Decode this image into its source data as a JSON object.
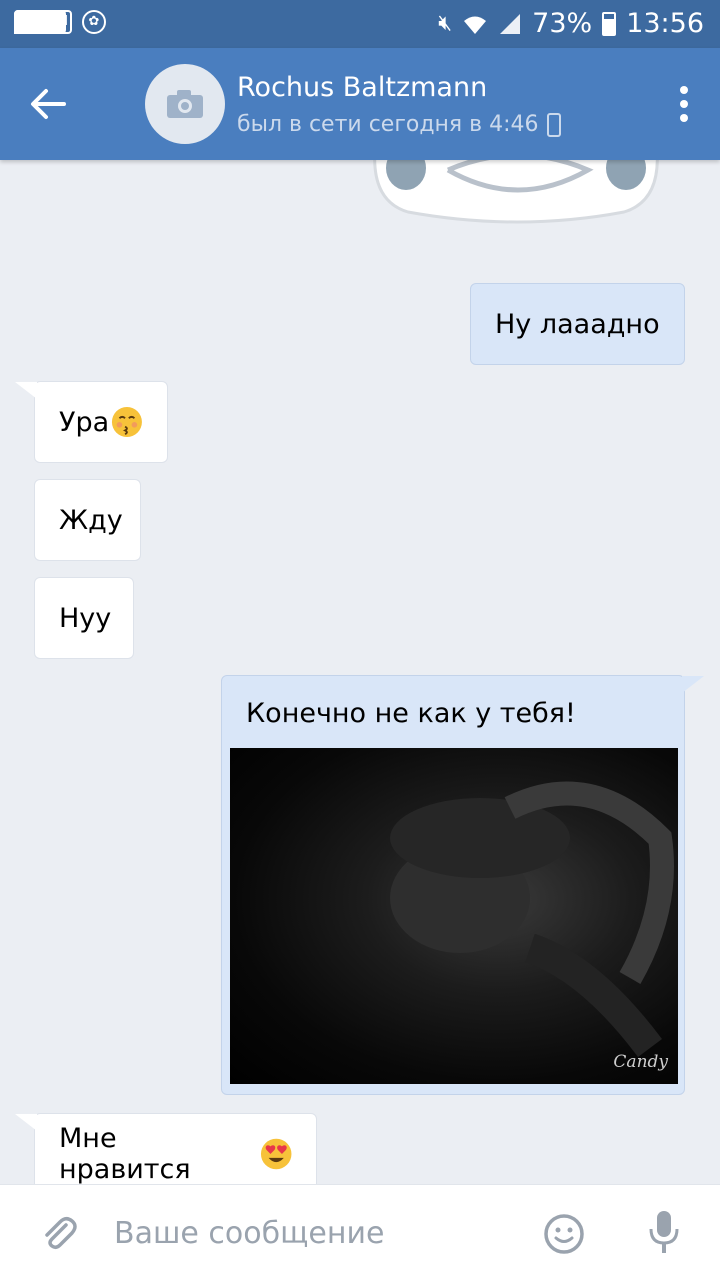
{
  "status_bar": {
    "battery": "73%",
    "time": "13:56",
    "icons": [
      "gallery-icon",
      "app-w-icon",
      "message-icon",
      "lion-app-icon",
      "mute-icon",
      "wifi-icon",
      "signal-icon",
      "battery-icon"
    ]
  },
  "header": {
    "name": "Rochus Baltzmann",
    "status": "был в сети сегодня в 4:46",
    "icons": [
      "back-arrow-icon",
      "camera-icon",
      "phone-icon",
      "more-vert-icon"
    ]
  },
  "messages": [
    {
      "dir": "out",
      "text": "Ну лааадно"
    },
    {
      "dir": "in",
      "text": "Ура",
      "emoji": "kissing-emoji"
    },
    {
      "dir": "in",
      "text": "Жду"
    },
    {
      "dir": "in",
      "text": "Нуу"
    },
    {
      "dir": "out",
      "text": "Конечно не как у тебя!",
      "photo_watermark": "Candy"
    },
    {
      "dir": "in",
      "text": "Мне нравится",
      "emoji": "heart-eyes-emoji"
    }
  ],
  "input": {
    "placeholder": "Ваше сообщение",
    "icons": [
      "paperclip-icon",
      "smile-icon",
      "mic-icon"
    ]
  },
  "colors": {
    "status_bar": "#3d6aa0",
    "header": "#4a7ebf",
    "chat_bg": "#ebeef3",
    "incoming_bubble": "#ffffff",
    "outgoing_bubble": "#d9e6f8"
  }
}
